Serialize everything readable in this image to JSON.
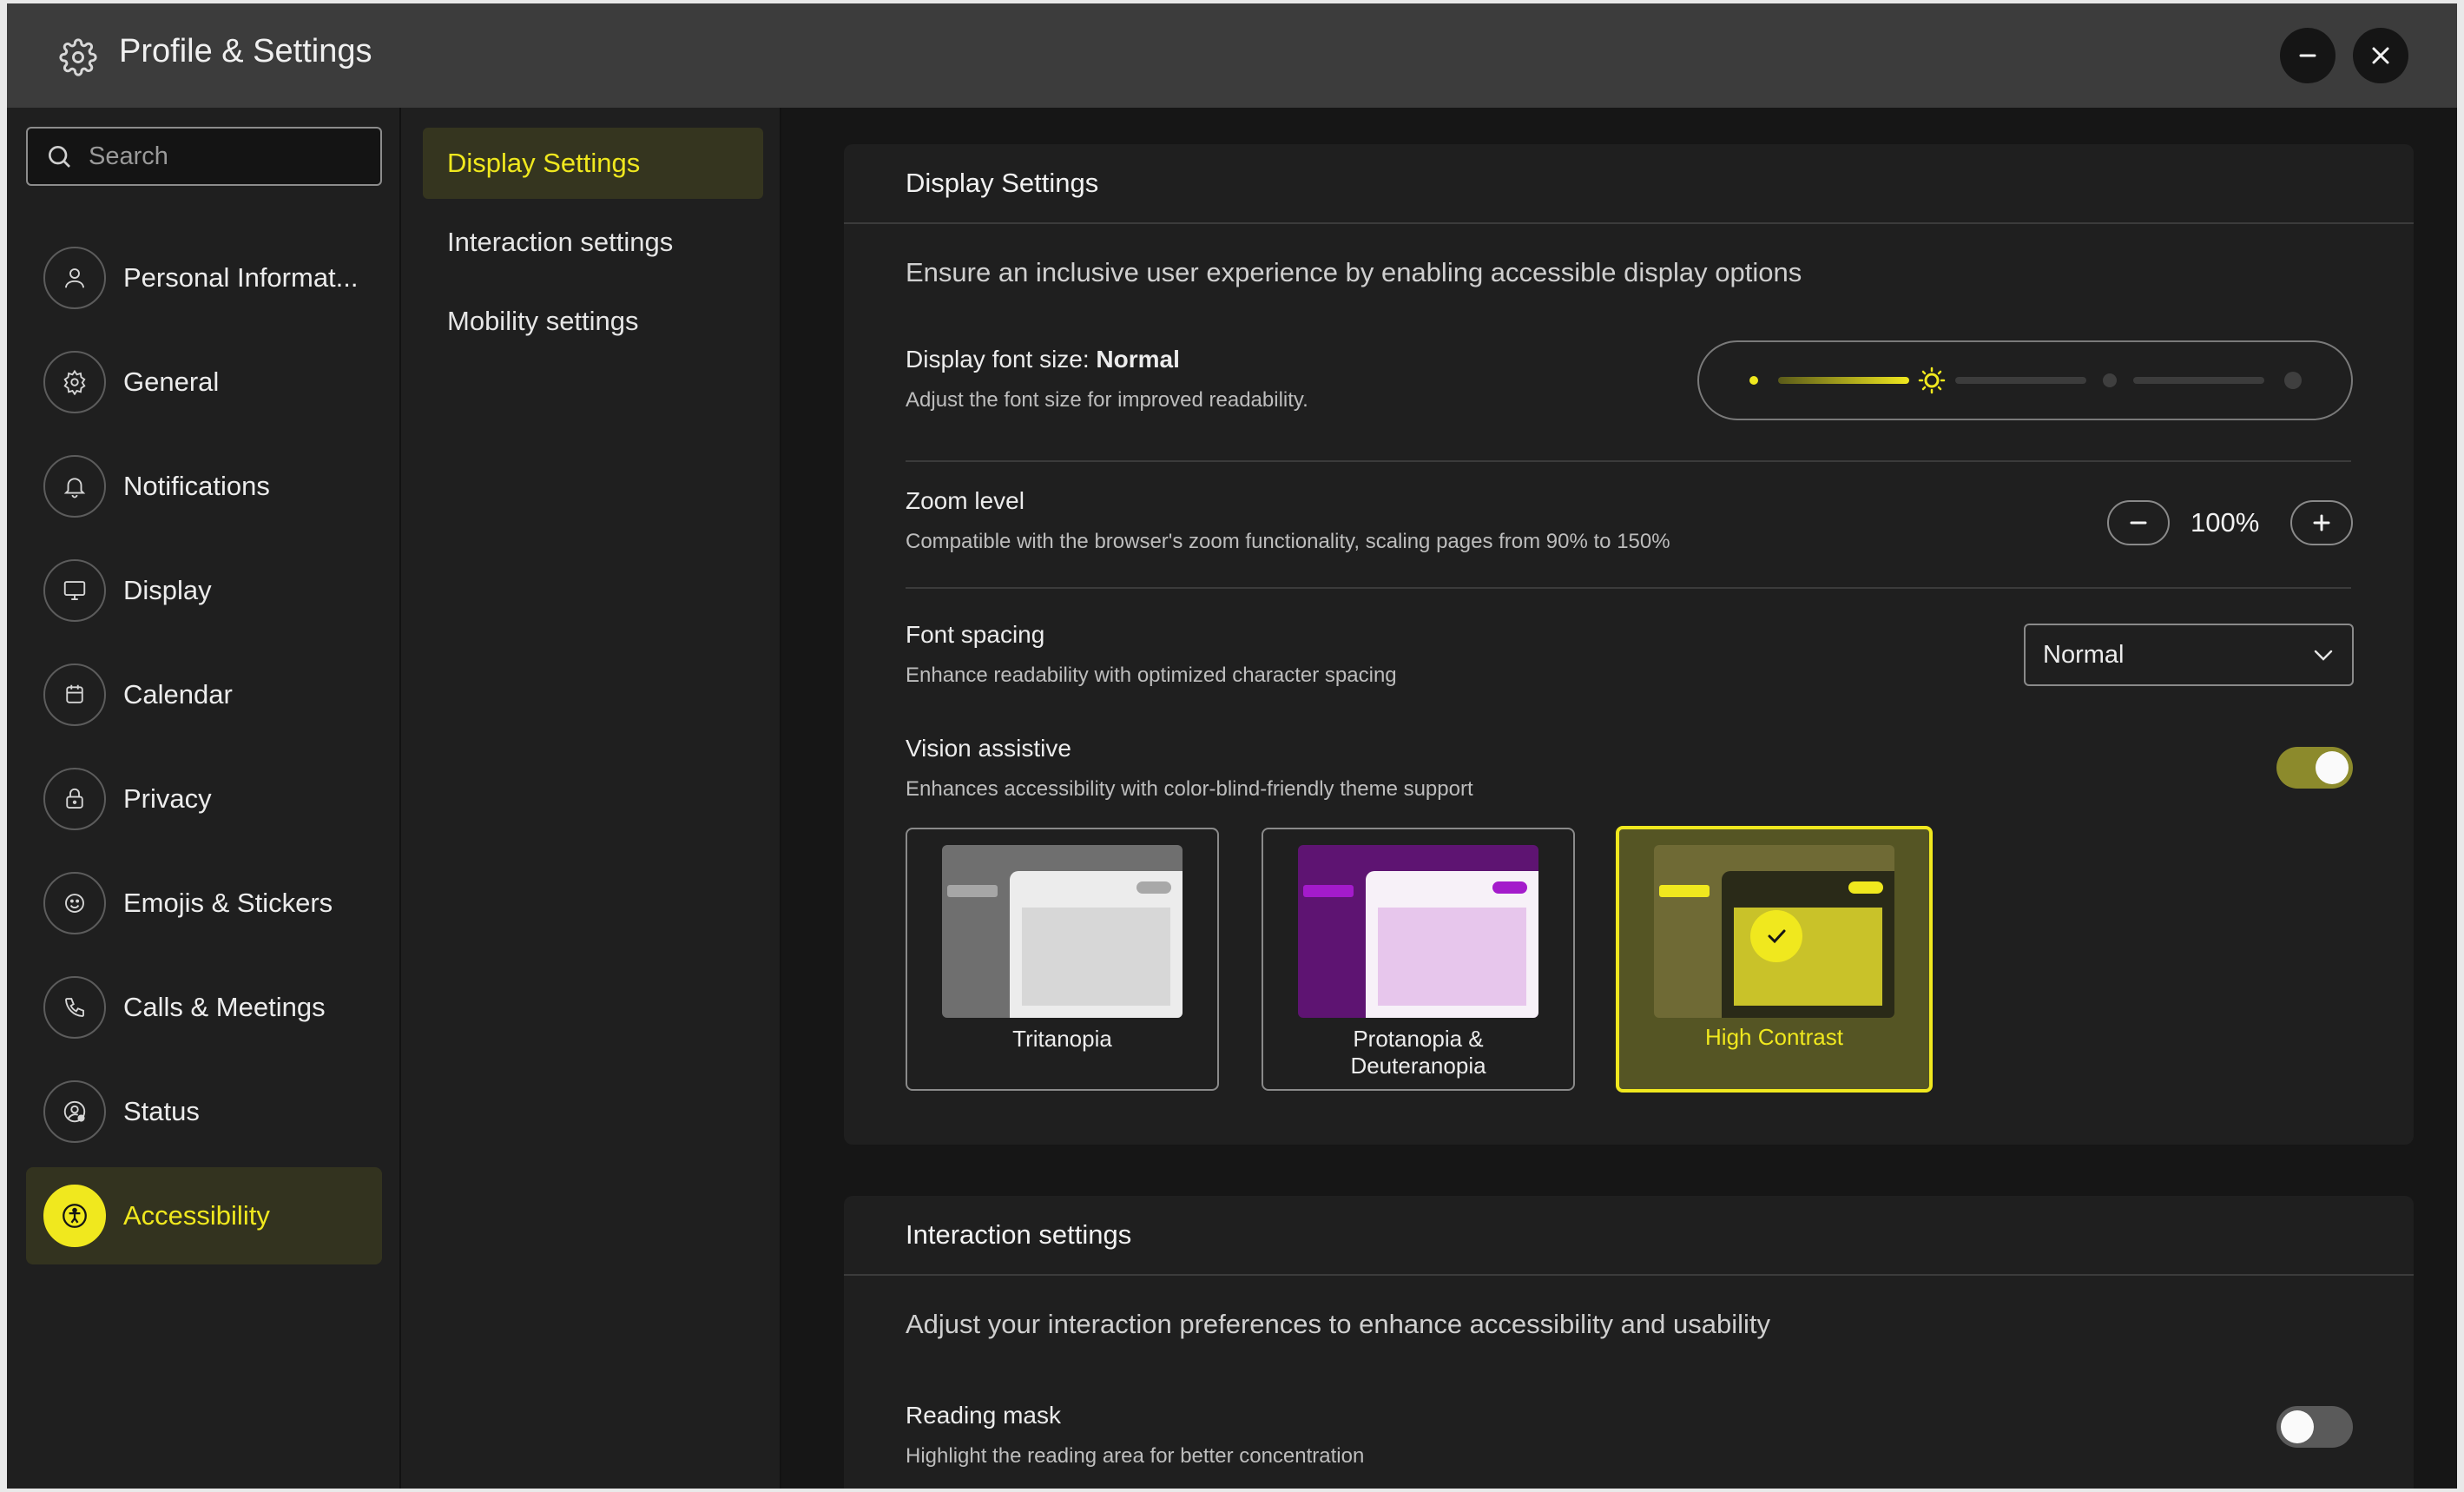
{
  "window": {
    "title": "Profile & Settings",
    "icon": "gear-icon",
    "minimize_icon": "minus-icon",
    "close_icon": "close-icon"
  },
  "sidebar": {
    "search_placeholder": "Search",
    "items": [
      {
        "label": "Personal Informat...",
        "icon": "user-icon"
      },
      {
        "label": "General",
        "icon": "gear-icon"
      },
      {
        "label": "Notifications",
        "icon": "bell-icon"
      },
      {
        "label": "Display",
        "icon": "monitor-icon"
      },
      {
        "label": "Calendar",
        "icon": "calendar-icon"
      },
      {
        "label": "Privacy",
        "icon": "lock-icon"
      },
      {
        "label": "Emojis & Stickers",
        "icon": "smiley-icon"
      },
      {
        "label": "Calls & Meetings",
        "icon": "phone-icon"
      },
      {
        "label": "Status",
        "icon": "user-status-icon"
      },
      {
        "label": "Accessibility",
        "icon": "accessibility-icon",
        "active": true
      }
    ]
  },
  "subnav": {
    "items": [
      {
        "label": "Display Settings",
        "active": true
      },
      {
        "label": "Interaction settings"
      },
      {
        "label": "Mobility settings"
      }
    ]
  },
  "display_settings": {
    "heading": "Display Settings",
    "description": "Ensure an inclusive user experience by enabling accessible display options",
    "font_size": {
      "label": "Display font size:",
      "value": "Normal",
      "sub": "Adjust the font size for improved readability.",
      "step_index": 1,
      "step_count": 4
    },
    "zoom": {
      "label": "Zoom level",
      "sub": "Compatible with the browser's zoom functionality, scaling pages from 90% to 150%",
      "value": "100%"
    },
    "font_spacing": {
      "label": "Font spacing",
      "sub": "Enhance readability with optimized character spacing",
      "value": "Normal"
    },
    "vision": {
      "label": "Vision assistive",
      "sub": "Enhances accessibility with color-blind-friendly theme support",
      "enabled": true,
      "themes": [
        {
          "label": "Tritanopia"
        },
        {
          "label": "Protanopia &\nDeuteranopia"
        },
        {
          "label": "High Contrast",
          "selected": true
        }
      ]
    }
  },
  "interaction_settings": {
    "heading": "Interaction settings",
    "description": "Adjust your interaction preferences to enhance accessibility and usability",
    "reading_mask": {
      "label": "Reading mask",
      "sub": "Highlight the reading area for better concentration",
      "enabled": false
    }
  },
  "colors": {
    "accent": "#f0e81e",
    "toggle_on": "#8c8a2c",
    "toggle_off": "#5a5a5a",
    "background": "#161616",
    "panel": "#1f1f1f"
  }
}
